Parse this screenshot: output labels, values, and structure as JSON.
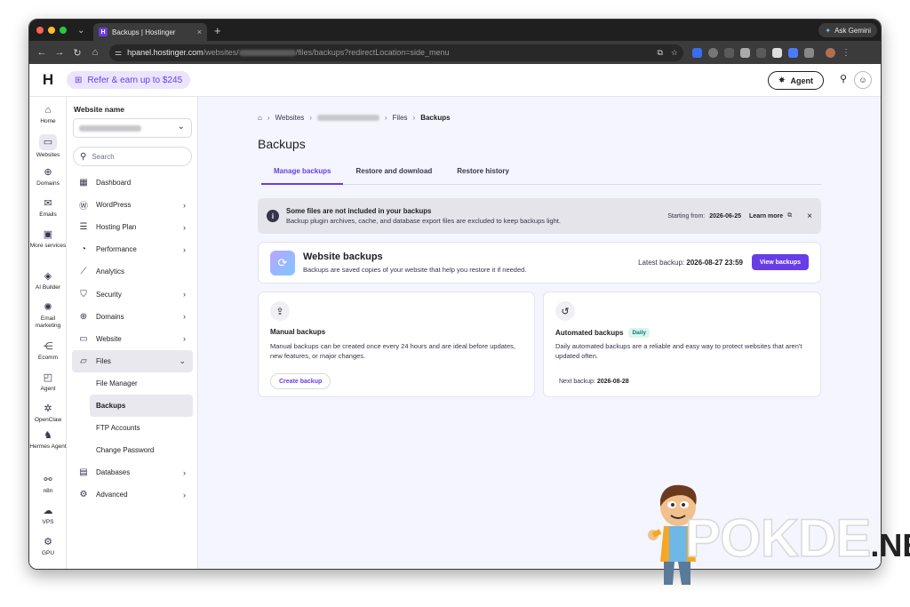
{
  "browser": {
    "tab_title": "Backups | Hostinger",
    "tab_close": "×",
    "new_tab": "+",
    "tab_dropdown": "⌄",
    "ask_gemini": "Ask Gemini",
    "url_host": "hpanel.hostinger.com",
    "url_mid": "/websites/",
    "url_tail": "/files/backups?redirectLocation=side_menu"
  },
  "appbar": {
    "logo": "H",
    "refer_label": "Refer & earn up to $245",
    "agent_label": "Agent"
  },
  "rail": [
    {
      "icon": "home-icon",
      "glyph": "⌂",
      "label": "Home"
    },
    {
      "icon": "websites-icon",
      "glyph": "▭",
      "label": "Websites"
    },
    {
      "icon": "globe-icon",
      "glyph": "⊕",
      "label": "Domains"
    },
    {
      "icon": "mail-icon",
      "glyph": "✉",
      "label": "Emails"
    },
    {
      "icon": "box-icon",
      "glyph": "▣",
      "label": "More services"
    },
    {
      "icon": "ai-builder-icon",
      "glyph": "◈",
      "label": "AI Builder"
    },
    {
      "icon": "email-marketing-icon",
      "glyph": "✺",
      "label": "Email marketing"
    },
    {
      "icon": "share-icon",
      "glyph": "⋲",
      "label": "Ecomm"
    },
    {
      "icon": "agent-icon",
      "glyph": "◰",
      "label": "Agent"
    },
    {
      "icon": "openclaw-icon",
      "glyph": "✲",
      "label": "OpenClaw"
    },
    {
      "icon": "hermes-icon",
      "glyph": "♞",
      "label": "Hermes Agent"
    },
    {
      "icon": "n8n-icon",
      "glyph": "⚯",
      "label": "n8n"
    },
    {
      "icon": "vps-icon",
      "glyph": "☁",
      "label": "VPS"
    },
    {
      "icon": "gpu-icon",
      "glyph": "⚙",
      "label": "GPU"
    }
  ],
  "sidebar": {
    "website_name_label": "Website name",
    "search_placeholder": "Search",
    "items": [
      {
        "icon": "dashboard-icon",
        "glyph": "▦",
        "label": "Dashboard",
        "arrow": ""
      },
      {
        "icon": "wordpress-icon",
        "glyph": "Ⓦ",
        "label": "WordPress",
        "arrow": "›"
      },
      {
        "icon": "hosting-plan-icon",
        "glyph": "☰",
        "label": "Hosting Plan",
        "arrow": "›"
      },
      {
        "icon": "performance-icon",
        "glyph": "◔",
        "label": "Performance",
        "arrow": "›"
      },
      {
        "icon": "analytics-icon",
        "glyph": "⟋",
        "label": "Analytics",
        "arrow": ""
      },
      {
        "icon": "security-icon",
        "glyph": "⛉",
        "label": "Security",
        "arrow": "›"
      },
      {
        "icon": "domains-icon",
        "glyph": "⊕",
        "label": "Domains",
        "arrow": "›"
      },
      {
        "icon": "website-icon",
        "glyph": "▭",
        "label": "Website",
        "arrow": "›"
      },
      {
        "icon": "files-icon",
        "glyph": "▱",
        "label": "Files",
        "arrow": "⌄"
      }
    ],
    "sub_items": [
      "File Manager",
      "Backups",
      "FTP Accounts",
      "Change Password"
    ],
    "items_after": [
      {
        "icon": "databases-icon",
        "glyph": "▤",
        "label": "Databases",
        "arrow": "›"
      },
      {
        "icon": "advanced-icon",
        "glyph": "⚙",
        "label": "Advanced",
        "arrow": "›"
      }
    ]
  },
  "breadcrumb": {
    "websites": "Websites",
    "files": "Files",
    "current": "Backups"
  },
  "page_title": "Backups",
  "tabs": [
    "Manage backups",
    "Restore and download",
    "Restore history"
  ],
  "alert": {
    "title": "Some files are not included in your backups",
    "body": "Backup plugin archives, cache, and database export files are excluded to keep backups light.",
    "starting_from_label": "Starting from:",
    "starting_from_date": "2026-06-25",
    "learn_more": "Learn more"
  },
  "website_backups": {
    "title": "Website backups",
    "subtitle": "Backups are saved copies of your website that help you restore it if needed.",
    "latest_label": "Latest backup:",
    "latest_value": "2026-08-27 23:59",
    "view_button": "View backups"
  },
  "manual_backups": {
    "title": "Manual backups",
    "description": "Manual backups can be created once every 24 hours and are ideal before updates, new features, or major changes.",
    "create_button": "Create backup"
  },
  "automated_backups": {
    "title": "Automated backups",
    "badge": "Daily",
    "description": "Daily automated backups are a reliable and easy way to protect websites that aren't updated often.",
    "next_label": "Next backup:",
    "next_value": "2026-08-28"
  },
  "watermark": {
    "brand": "POKDE",
    "suffix": ".NET"
  },
  "colors": {
    "accent": "#673de6",
    "accent_light": "#ebe4ff",
    "page_bg": "#f4f5ff"
  }
}
